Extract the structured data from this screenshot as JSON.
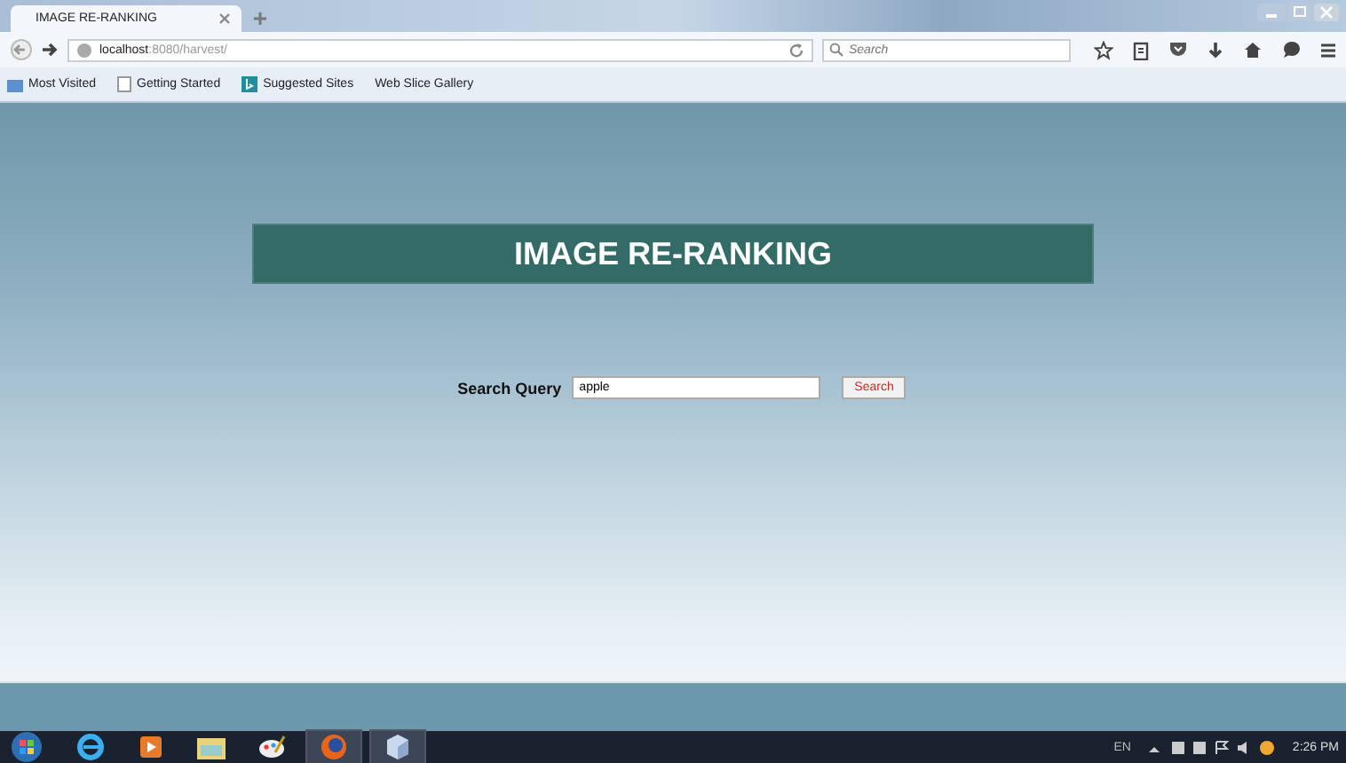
{
  "browser": {
    "tabs": [
      {
        "title": "IMAGE RE-RANKING",
        "selected": true
      }
    ],
    "url": {
      "host": "localhost",
      "rest": ":8080/harvest/"
    },
    "search": {
      "placeholder": "Search"
    },
    "bookmarks": [
      {
        "label": "Most Visited",
        "kind": "folder"
      },
      {
        "label": "Getting Started",
        "kind": "page"
      },
      {
        "label": "Suggested Sites",
        "kind": "bing"
      },
      {
        "label": "Web Slice Gallery",
        "kind": "none"
      }
    ]
  },
  "page": {
    "heading": "IMAGE RE-RANKING",
    "query_label": "Search Query",
    "query_value": "apple",
    "button": "Search"
  },
  "taskbar": {
    "apps": [
      {
        "kind": "ie",
        "active": false
      },
      {
        "kind": "media",
        "active": false
      },
      {
        "kind": "files",
        "active": false
      },
      {
        "kind": "paint",
        "active": false
      },
      {
        "kind": "firefox",
        "active": true
      },
      {
        "kind": "box",
        "active": true
      }
    ],
    "language": "EN",
    "clock": "2:26 PM"
  }
}
